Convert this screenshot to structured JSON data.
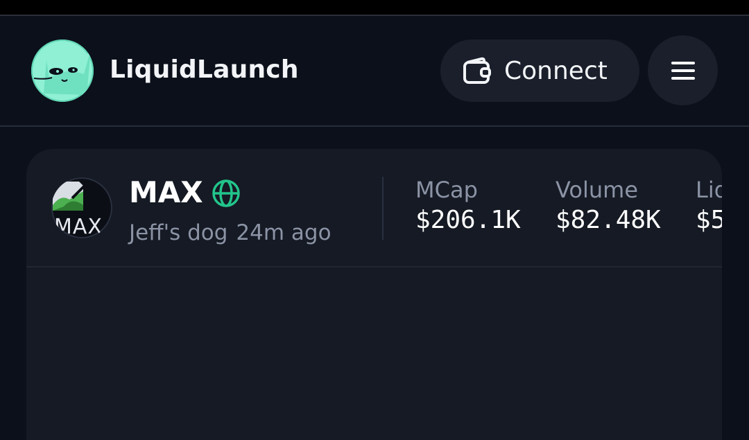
{
  "header": {
    "brand": "LiquidLaunch",
    "connect_label": "Connect"
  },
  "token": {
    "avatar_alt": "MAX",
    "name": "MAX",
    "creator": "Jeff's dog",
    "age": "24m ago"
  },
  "stats": [
    {
      "label": "MCap",
      "value": "$206.1K"
    },
    {
      "label": "Volume",
      "value": "$82.48K"
    },
    {
      "label": "Liquidity",
      "value": "$5"
    }
  ],
  "colors": {
    "background": "#0b101b",
    "card": "#151a24",
    "accent": "#8ff0d4",
    "web_icon": "#22c58b",
    "muted_text": "#8b93a5"
  },
  "icons": {
    "logo": "cat-logo-icon",
    "connect": "wallet-icon",
    "menu": "hamburger-menu-icon",
    "website": "globe-icon"
  }
}
